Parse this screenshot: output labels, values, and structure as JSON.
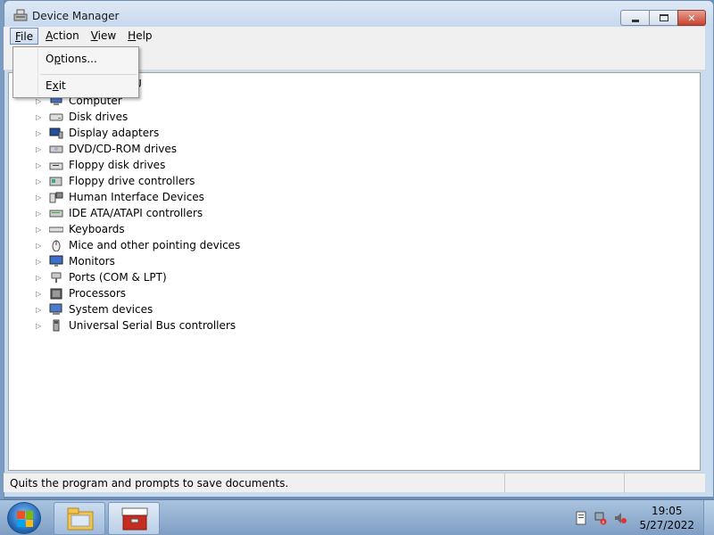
{
  "window": {
    "title": "Device Manager",
    "icon": "device-manager-icon"
  },
  "menubar": {
    "items": [
      {
        "label": "File",
        "accel": "F",
        "rest": "ile"
      },
      {
        "label": "Action",
        "accel": "A",
        "rest": "ction"
      },
      {
        "label": "View",
        "accel": "V",
        "rest": "iew"
      },
      {
        "label": "Help",
        "accel": "H",
        "rest": "elp"
      }
    ]
  },
  "file_menu": {
    "options_accel": "p",
    "options_pre": "O",
    "options_post": "tions...",
    "exit_accel": "x",
    "exit_pre": "E",
    "exit_post": "it"
  },
  "tree": {
    "root_partial": "U",
    "items": [
      {
        "label": "Computer",
        "icon": "computer-icon"
      },
      {
        "label": "Disk drives",
        "icon": "disk-drive-icon"
      },
      {
        "label": "Display adapters",
        "icon": "display-adapter-icon"
      },
      {
        "label": "DVD/CD-ROM drives",
        "icon": "dvd-drive-icon"
      },
      {
        "label": "Floppy disk drives",
        "icon": "floppy-drive-icon"
      },
      {
        "label": "Floppy drive controllers",
        "icon": "floppy-controller-icon"
      },
      {
        "label": "Human Interface Devices",
        "icon": "hid-icon"
      },
      {
        "label": "IDE ATA/ATAPI controllers",
        "icon": "ide-controller-icon"
      },
      {
        "label": "Keyboards",
        "icon": "keyboard-icon"
      },
      {
        "label": "Mice and other pointing devices",
        "icon": "mouse-icon"
      },
      {
        "label": "Monitors",
        "icon": "monitor-icon"
      },
      {
        "label": "Ports (COM & LPT)",
        "icon": "port-icon"
      },
      {
        "label": "Processors",
        "icon": "processor-icon"
      },
      {
        "label": "System devices",
        "icon": "system-device-icon"
      },
      {
        "label": "Universal Serial Bus controllers",
        "icon": "usb-icon"
      }
    ]
  },
  "statusbar": {
    "text": "Quits the program and prompts to save documents."
  },
  "taskbar": {
    "clock_time": "19:05",
    "clock_date": "5/27/2022",
    "buttons": [
      {
        "icon": "explorer-folder-icon"
      },
      {
        "icon": "toolbox-icon"
      }
    ]
  }
}
